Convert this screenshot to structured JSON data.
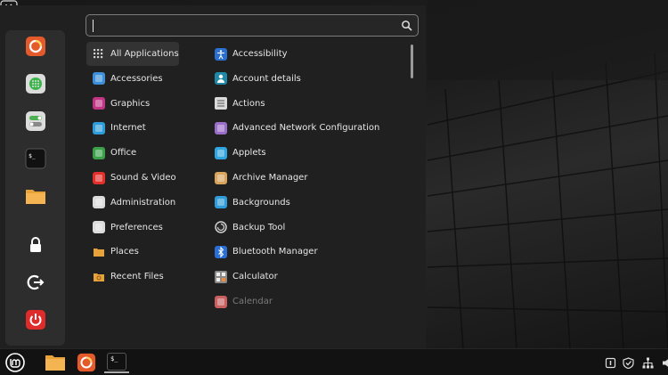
{
  "menu": {
    "search": {
      "value": "",
      "placeholder": ""
    },
    "categories": [
      {
        "label": "All Applications",
        "icon": "grid-icon",
        "color": "#d0d0d0"
      },
      {
        "label": "Accessories",
        "icon": "accessories-icon",
        "color": "#3d8fd9"
      },
      {
        "label": "Graphics",
        "icon": "graphics-icon",
        "color": "#c13584"
      },
      {
        "label": "Internet",
        "icon": "internet-icon",
        "color": "#2f9bd8"
      },
      {
        "label": "Office",
        "icon": "office-icon",
        "color": "#3aa14a"
      },
      {
        "label": "Sound & Video",
        "icon": "sound-video-icon",
        "color": "#e0302a"
      },
      {
        "label": "Administration",
        "icon": "administration-icon",
        "color": "#dcdcdc"
      },
      {
        "label": "Preferences",
        "icon": "preferences-icon",
        "color": "#dcdcdc"
      },
      {
        "label": "Places",
        "icon": "folder-icon",
        "color": "#e8a23a"
      },
      {
        "label": "Recent Files",
        "icon": "recent-folder-icon",
        "color": "#e8a23a"
      }
    ],
    "applications": [
      {
        "label": "Accessibility",
        "icon": "accessibility-icon",
        "color": "#2b6fcf"
      },
      {
        "label": "Account details",
        "icon": "account-icon",
        "color": "#1f8aa8"
      },
      {
        "label": "Actions",
        "icon": "actions-icon",
        "color": "#d9d9d9"
      },
      {
        "label": "Advanced Network Configuration",
        "icon": "network-icon",
        "color": "#9b6fc9"
      },
      {
        "label": "Applets",
        "icon": "applets-icon",
        "color": "#2fa6e0"
      },
      {
        "label": "Archive Manager",
        "icon": "archive-icon",
        "color": "#d9a45c"
      },
      {
        "label": "Backgrounds",
        "icon": "backgrounds-icon",
        "color": "#2f9bd8"
      },
      {
        "label": "Backup Tool",
        "icon": "backup-icon",
        "color": "#cfcfcf"
      },
      {
        "label": "Bluetooth Manager",
        "icon": "bluetooth-icon",
        "color": "#2a6fd6"
      },
      {
        "label": "Calculator",
        "icon": "calculator-icon",
        "color": "#8a8a8a"
      },
      {
        "label": "Calendar",
        "icon": "calendar-icon",
        "color": "#c86060"
      }
    ],
    "favorites": [
      {
        "name": "firefox-icon",
        "color": "#e55a2b"
      },
      {
        "name": "apps-icon",
        "color": "#3ab54a"
      },
      {
        "name": "toggle-settings-icon",
        "color": "#4caf50"
      },
      {
        "name": "terminal-icon",
        "color": "#111111"
      },
      {
        "name": "folder-icon",
        "color": "#e8a23a"
      },
      {
        "name": "lock-icon",
        "color": "#ffffff"
      },
      {
        "name": "logout-icon",
        "color": "#ffffff"
      },
      {
        "name": "power-icon",
        "color": "#e02b2b"
      }
    ]
  },
  "panel": {
    "terminal_text": "$_"
  },
  "colors": {
    "accent": "#7d7d7d",
    "panel": "#121212",
    "menu": "#202020"
  }
}
